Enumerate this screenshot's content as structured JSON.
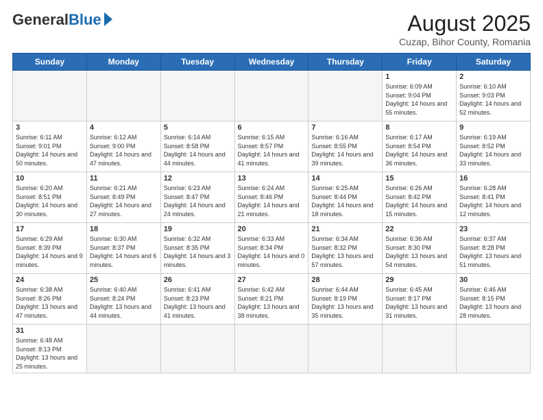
{
  "header": {
    "logo_general": "General",
    "logo_blue": "Blue",
    "month_title": "August 2025",
    "location": "Cuzap, Bihor County, Romania"
  },
  "weekdays": [
    "Sunday",
    "Monday",
    "Tuesday",
    "Wednesday",
    "Thursday",
    "Friday",
    "Saturday"
  ],
  "weeks": [
    [
      {
        "day": "",
        "info": ""
      },
      {
        "day": "",
        "info": ""
      },
      {
        "day": "",
        "info": ""
      },
      {
        "day": "",
        "info": ""
      },
      {
        "day": "",
        "info": ""
      },
      {
        "day": "1",
        "info": "Sunrise: 6:09 AM\nSunset: 9:04 PM\nDaylight: 14 hours and 55 minutes."
      },
      {
        "day": "2",
        "info": "Sunrise: 6:10 AM\nSunset: 9:03 PM\nDaylight: 14 hours and 52 minutes."
      }
    ],
    [
      {
        "day": "3",
        "info": "Sunrise: 6:11 AM\nSunset: 9:01 PM\nDaylight: 14 hours and 50 minutes."
      },
      {
        "day": "4",
        "info": "Sunrise: 6:12 AM\nSunset: 9:00 PM\nDaylight: 14 hours and 47 minutes."
      },
      {
        "day": "5",
        "info": "Sunrise: 6:14 AM\nSunset: 8:58 PM\nDaylight: 14 hours and 44 minutes."
      },
      {
        "day": "6",
        "info": "Sunrise: 6:15 AM\nSunset: 8:57 PM\nDaylight: 14 hours and 41 minutes."
      },
      {
        "day": "7",
        "info": "Sunrise: 6:16 AM\nSunset: 8:55 PM\nDaylight: 14 hours and 39 minutes."
      },
      {
        "day": "8",
        "info": "Sunrise: 6:17 AM\nSunset: 8:54 PM\nDaylight: 14 hours and 36 minutes."
      },
      {
        "day": "9",
        "info": "Sunrise: 6:19 AM\nSunset: 8:52 PM\nDaylight: 14 hours and 33 minutes."
      }
    ],
    [
      {
        "day": "10",
        "info": "Sunrise: 6:20 AM\nSunset: 8:51 PM\nDaylight: 14 hours and 30 minutes."
      },
      {
        "day": "11",
        "info": "Sunrise: 6:21 AM\nSunset: 8:49 PM\nDaylight: 14 hours and 27 minutes."
      },
      {
        "day": "12",
        "info": "Sunrise: 6:23 AM\nSunset: 8:47 PM\nDaylight: 14 hours and 24 minutes."
      },
      {
        "day": "13",
        "info": "Sunrise: 6:24 AM\nSunset: 8:46 PM\nDaylight: 14 hours and 21 minutes."
      },
      {
        "day": "14",
        "info": "Sunrise: 6:25 AM\nSunset: 8:44 PM\nDaylight: 14 hours and 18 minutes."
      },
      {
        "day": "15",
        "info": "Sunrise: 6:26 AM\nSunset: 8:42 PM\nDaylight: 14 hours and 15 minutes."
      },
      {
        "day": "16",
        "info": "Sunrise: 6:28 AM\nSunset: 8:41 PM\nDaylight: 14 hours and 12 minutes."
      }
    ],
    [
      {
        "day": "17",
        "info": "Sunrise: 6:29 AM\nSunset: 8:39 PM\nDaylight: 14 hours and 9 minutes."
      },
      {
        "day": "18",
        "info": "Sunrise: 6:30 AM\nSunset: 8:37 PM\nDaylight: 14 hours and 6 minutes."
      },
      {
        "day": "19",
        "info": "Sunrise: 6:32 AM\nSunset: 8:35 PM\nDaylight: 14 hours and 3 minutes."
      },
      {
        "day": "20",
        "info": "Sunrise: 6:33 AM\nSunset: 8:34 PM\nDaylight: 14 hours and 0 minutes."
      },
      {
        "day": "21",
        "info": "Sunrise: 6:34 AM\nSunset: 8:32 PM\nDaylight: 13 hours and 57 minutes."
      },
      {
        "day": "22",
        "info": "Sunrise: 6:36 AM\nSunset: 8:30 PM\nDaylight: 13 hours and 54 minutes."
      },
      {
        "day": "23",
        "info": "Sunrise: 6:37 AM\nSunset: 8:28 PM\nDaylight: 13 hours and 51 minutes."
      }
    ],
    [
      {
        "day": "24",
        "info": "Sunrise: 6:38 AM\nSunset: 8:26 PM\nDaylight: 13 hours and 47 minutes."
      },
      {
        "day": "25",
        "info": "Sunrise: 6:40 AM\nSunset: 8:24 PM\nDaylight: 13 hours and 44 minutes."
      },
      {
        "day": "26",
        "info": "Sunrise: 6:41 AM\nSunset: 8:23 PM\nDaylight: 13 hours and 41 minutes."
      },
      {
        "day": "27",
        "info": "Sunrise: 6:42 AM\nSunset: 8:21 PM\nDaylight: 13 hours and 38 minutes."
      },
      {
        "day": "28",
        "info": "Sunrise: 6:44 AM\nSunset: 8:19 PM\nDaylight: 13 hours and 35 minutes."
      },
      {
        "day": "29",
        "info": "Sunrise: 6:45 AM\nSunset: 8:17 PM\nDaylight: 13 hours and 31 minutes."
      },
      {
        "day": "30",
        "info": "Sunrise: 6:46 AM\nSunset: 8:15 PM\nDaylight: 13 hours and 28 minutes."
      }
    ],
    [
      {
        "day": "31",
        "info": "Sunrise: 6:48 AM\nSunset: 8:13 PM\nDaylight: 13 hours and 25 minutes."
      },
      {
        "day": "",
        "info": ""
      },
      {
        "day": "",
        "info": ""
      },
      {
        "day": "",
        "info": ""
      },
      {
        "day": "",
        "info": ""
      },
      {
        "day": "",
        "info": ""
      },
      {
        "day": "",
        "info": ""
      }
    ]
  ]
}
